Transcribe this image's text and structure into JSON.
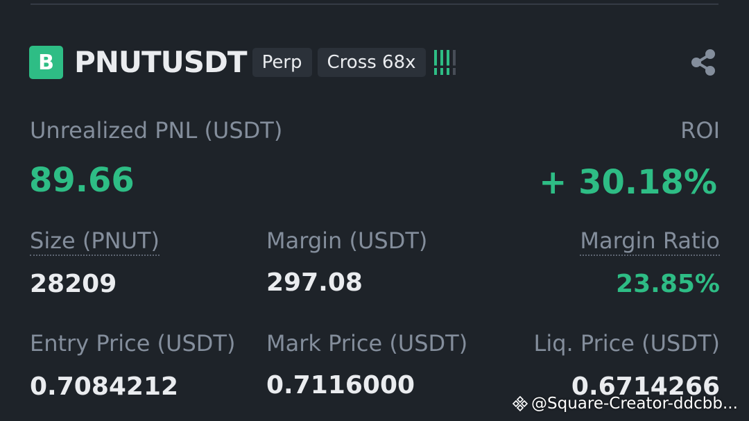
{
  "header": {
    "badge_letter": "B",
    "symbol": "PNUTUSDT",
    "contract_type": "Perp",
    "margin_mode": "Cross 68x",
    "share_icon": "share-icon",
    "signal_icon": "signal-strength-icon"
  },
  "pnl": {
    "label": "Unrealized PNL (USDT)",
    "value": "89.66",
    "roi_label": "ROI",
    "roi_value": "+ 30.18%"
  },
  "stats_row1": {
    "size_label": "Size (PNUT)",
    "size_value": "28209",
    "margin_label": "Margin (USDT)",
    "margin_value": "297.08",
    "margin_ratio_label": "Margin Ratio",
    "margin_ratio_value": "23.85%"
  },
  "stats_row2": {
    "entry_label": "Entry Price (USDT)",
    "entry_value": "0.7084212",
    "mark_label": "Mark Price (USDT)",
    "mark_value": "0.7116000",
    "liq_label": "Liq. Price (USDT)",
    "liq_value": "0.6714266"
  },
  "watermark": {
    "text": "@Square-Creator-ddcbb..."
  },
  "colors": {
    "background": "#1e2329",
    "positive": "#2ebd85",
    "primary_text": "#eaecef",
    "secondary_text": "#848e9c",
    "tag_background": "#2b3139"
  }
}
